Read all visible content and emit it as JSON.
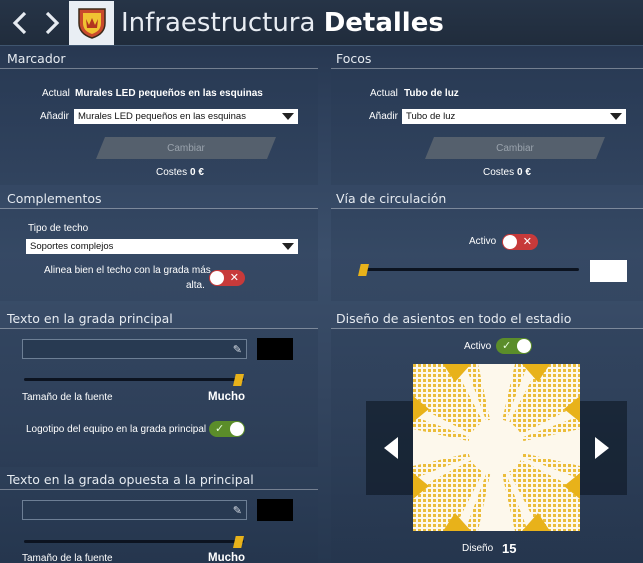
{
  "header": {
    "title_light": "Infraestructura",
    "title_bold": "Detalles"
  },
  "marcador": {
    "section_title": "Marcador",
    "actual_label": "Actual",
    "actual_value": "Murales LED pequeños en las esquinas",
    "add_label": "Añadir",
    "add_selected": "Murales LED pequeños en las esquinas",
    "change_button": "Cambiar",
    "cost_label": "Costes",
    "cost_value": "0 €"
  },
  "focos": {
    "section_title": "Focos",
    "actual_label": "Actual",
    "actual_value": "Tubo de luz",
    "add_label": "Añadir",
    "add_selected": "Tubo de luz",
    "change_button": "Cambiar",
    "cost_label": "Costes",
    "cost_value": "0 €"
  },
  "complementos": {
    "section_title": "Complementos",
    "roof_type_label": "Tipo de techo",
    "roof_type_selected": "Soportes complejos",
    "align_label_line1": "Alinea bien el techo con la grada más",
    "align_label_line2": "alta.",
    "align_state": "off"
  },
  "via": {
    "section_title": "Vía de circulación",
    "active_label": "Activo",
    "active_state": "off",
    "slider_level": 0,
    "color": "#ffffff"
  },
  "texto_principal": {
    "section_title": "Texto en la grada principal",
    "input_value": "",
    "color": "#000000",
    "font_size_label": "Tamaño de la fuente",
    "font_size_value": "Mucho",
    "slider_level": 1,
    "logo_label": "Logotipo del equipo en la grada principal",
    "logo_state": "on"
  },
  "diseno": {
    "section_title": "Diseño de asientos en todo el estadio",
    "active_label": "Activo",
    "active_state": "on",
    "design_label": "Diseño",
    "design_value": "15"
  },
  "texto_opuesta": {
    "section_title": "Texto en la grada opuesta a la principal",
    "input_value": "",
    "color": "#000000",
    "font_size_label": "Tamaño de la fuente",
    "font_size_value": "Mucho",
    "slider_level": 1
  },
  "colors": {
    "accent_yellow": "#e8b21a",
    "toggle_off": "#c73a3a",
    "toggle_on": "#5b8d2a"
  },
  "icons": {
    "back": "chevron-left-icon",
    "forward": "chevron-right-icon",
    "badge": "club-crest-icon",
    "pen": "pencil-icon"
  }
}
